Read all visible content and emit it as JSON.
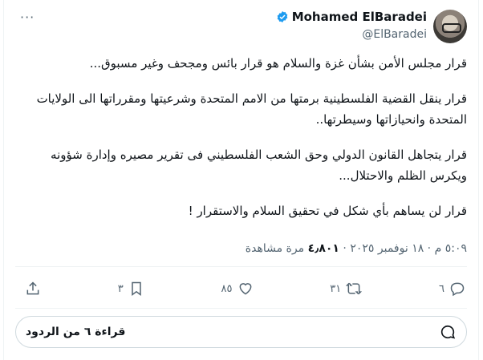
{
  "author": {
    "name": "Mohamed ElBaradei",
    "handle": "@ElBaradei",
    "verified": true
  },
  "more_label": "···",
  "tweet": {
    "paragraphs": [
      "قرار مجلس الأمن بشأن غزة والسلام هو قرار بائس ومجحف وغير مسبوق...",
      "قرار ينقل القضية الفلسطينية برمتها من الامم المتحدة وشرعيتها ومقرراتها الى الولايات المتحدة وانحيازاتها وسيطرتها..",
      "قرار يتجاهل القانون الدولي وحق الشعب الفلسطيني فى تقرير مصيره وإدارة شؤونه ويكرس الظلم والاحتلال...",
      "قرار لن يساهم بأي شكل في تحقيق السلام والاستقرار !"
    ]
  },
  "meta": {
    "time": "٥:٠٩ م",
    "date": "١٨ نوفمبر ٢٠٢٥",
    "views_count": "٤٫٨٠١",
    "views_label": "مرة مشاهدة"
  },
  "actions": {
    "reply_count": "٦",
    "repost_count": "٣١",
    "like_count": "٨٥",
    "bookmark_count": "٣",
    "share_label": ""
  },
  "replies_bar": {
    "label": "قراءة ٦ من الردود"
  },
  "colors": {
    "verified": "#1d9bf0",
    "muted": "#536471",
    "text": "#0f1419"
  }
}
